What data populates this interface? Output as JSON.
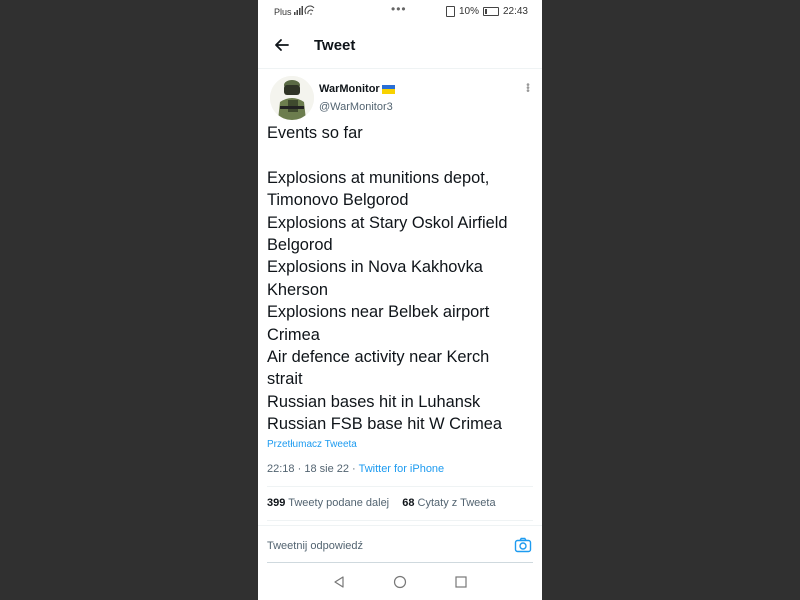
{
  "status_bar": {
    "carrier": "Plus",
    "battery": "10%",
    "time": "22:43"
  },
  "header": {
    "title": "Tweet"
  },
  "tweet": {
    "display_name": "WarMonitor",
    "handle": "@WarMonitor3",
    "text": "Events so far\n\nExplosions at munitions depot,\nTimonovo Belgorod\nExplosions at Stary Oskol Airfield\nBelgorod\nExplosions in Nova Kakhovka\nKherson\nExplosions near Belbek airport\nCrimea\nAir defence activity near Kerch\nstrait\nRussian bases hit in Luhansk\nRussian FSB base hit W Crimea",
    "translate_label": "Przetłumacz Tweeta",
    "time": "22:18",
    "date": "18 sie 22",
    "separator": "·",
    "source": "Twitter for iPhone",
    "retweets_count": "399",
    "retweets_label": "Tweety podane dalej",
    "quotes_count": "68",
    "quotes_label": "Cytaty z Tweeta"
  },
  "reply": {
    "placeholder": "Tweetnij odpowiedź"
  },
  "colors": {
    "accent": "#1d9bf0",
    "text_primary": "#0f1419",
    "text_secondary": "#536471",
    "flag_blue": "#2a6fd6",
    "flag_yellow": "#f8d200"
  },
  "icons": {
    "back": "arrow-left-icon",
    "more": "more-vertical-icon",
    "camera": "camera-icon",
    "nav_back": "triangle-back-icon",
    "nav_home": "circle-home-icon",
    "nav_recent": "square-recent-icon"
  }
}
